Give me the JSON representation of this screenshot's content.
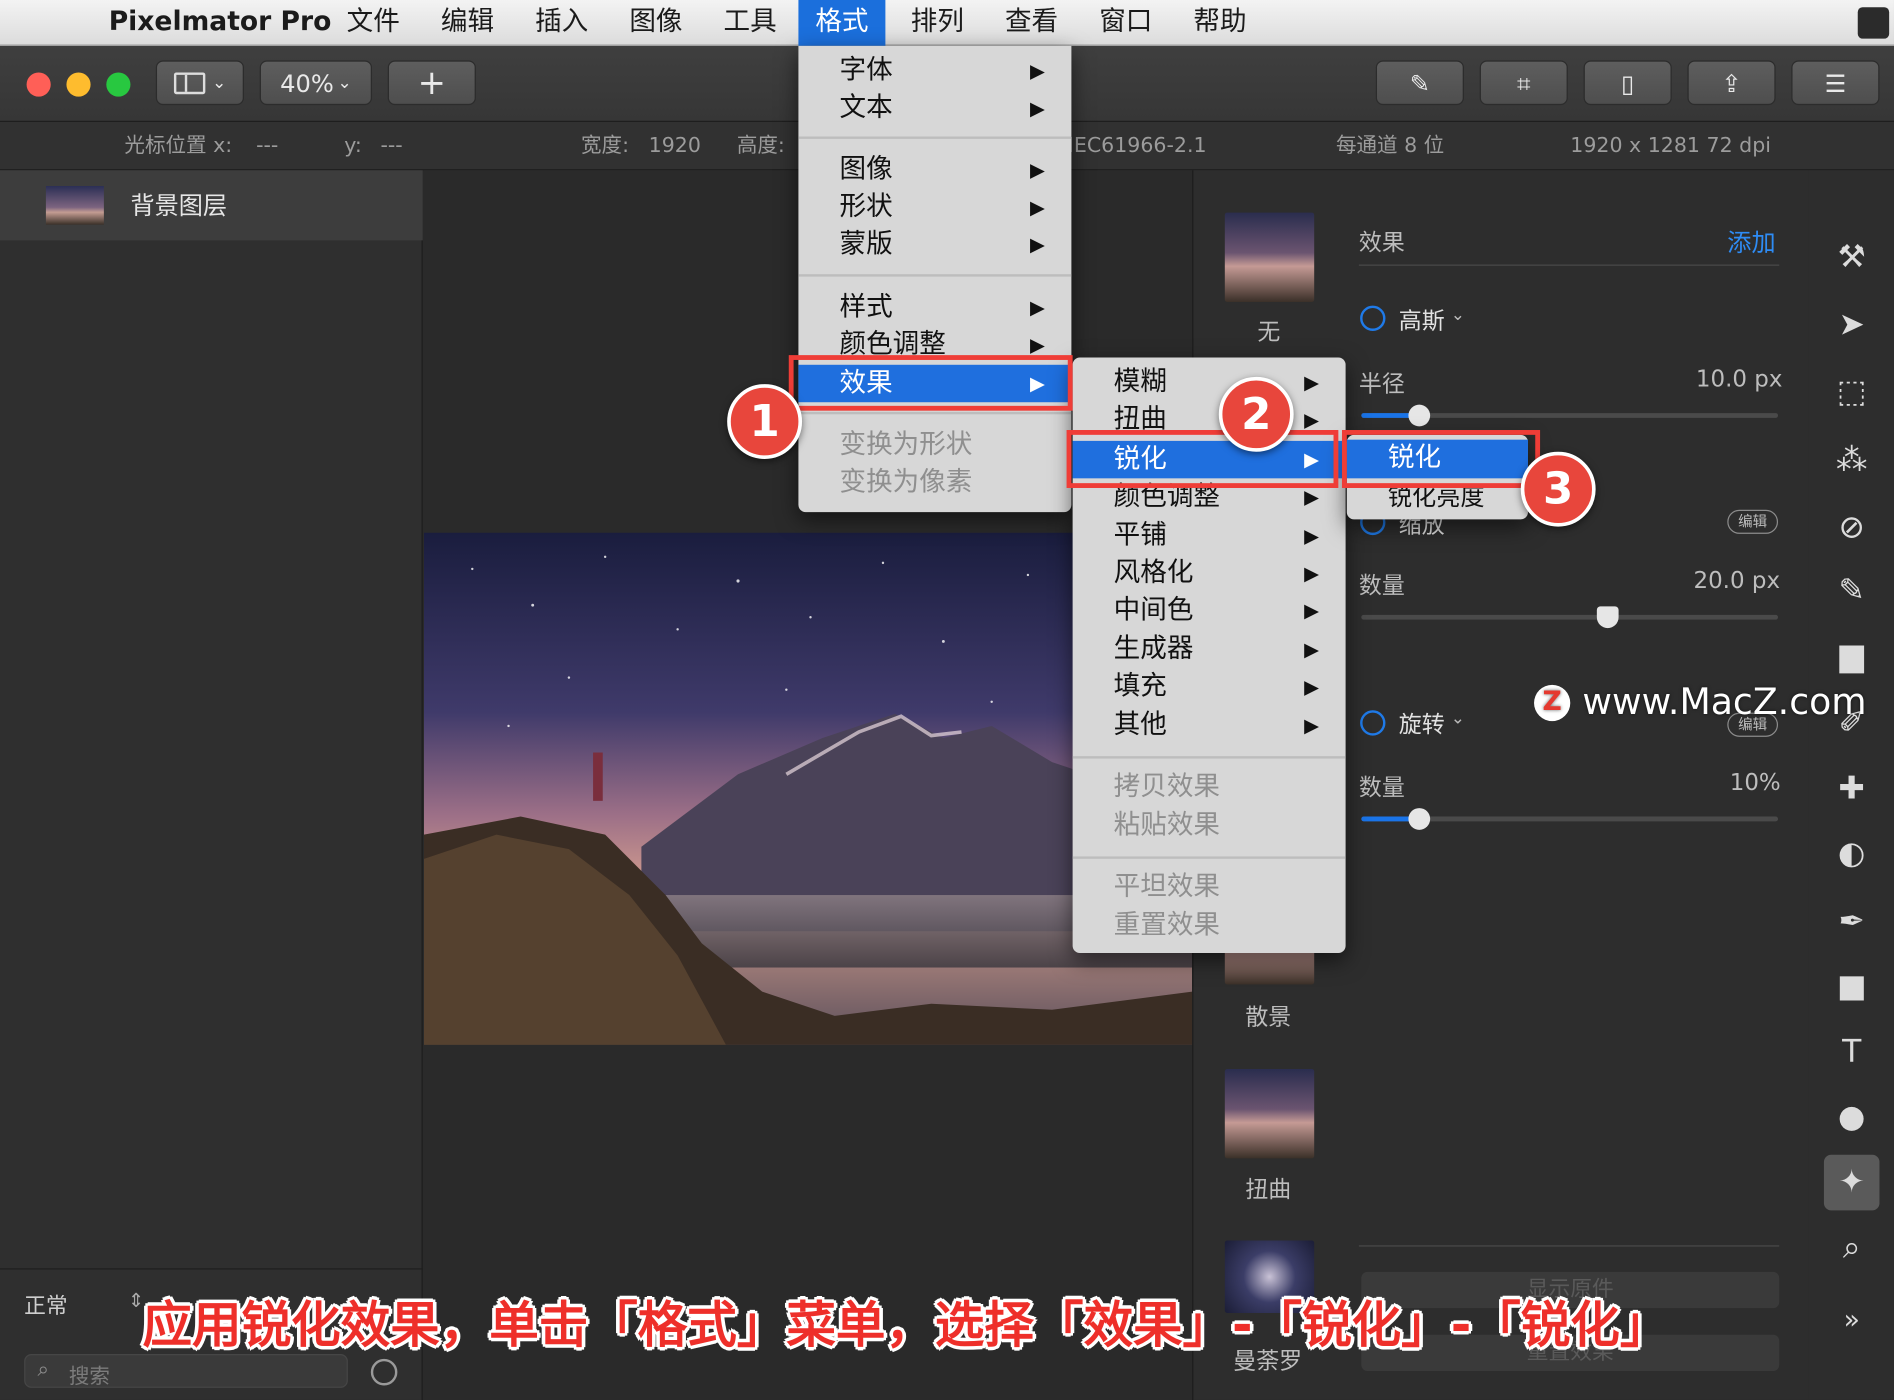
{
  "menubar": {
    "app_name": "Pixelmator Pro",
    "items": [
      "文件",
      "编辑",
      "插入",
      "图像",
      "工具",
      "格式",
      "排列",
      "查看",
      "窗口",
      "帮助"
    ],
    "active_item": "格式"
  },
  "toolbar": {
    "zoom": "40%",
    "add_label": "+"
  },
  "infobar": {
    "cursor_x_label": "光标位置 x:",
    "cursor_x_value": "---",
    "cursor_y_label": "y:",
    "cursor_y_value": "---",
    "width_label": "宽度:",
    "width_value": "1920",
    "height_label": "高度:",
    "color_profile": "IEC61966-2.1",
    "bit_depth": "每通道 8 位",
    "size_dpi": "1920 x 1281 72 dpi"
  },
  "layers": {
    "items": [
      "背景图层"
    ],
    "blend_mode": "正常",
    "search_placeholder": "搜索"
  },
  "effects_panel": {
    "title": "效果",
    "add_label": "添加",
    "presets": [
      "无",
      "散景",
      "扭曲",
      "曼荼罗"
    ],
    "effects": [
      {
        "name": "高斯",
        "param": "半径",
        "value": "10.0 px",
        "level": 0.14
      },
      {
        "name": "缩放",
        "param": "数量",
        "value": "20.0 px",
        "level": 0.59,
        "edit_label": "编辑"
      },
      {
        "name": "旋转",
        "param": "数量",
        "value": "10%",
        "level": 0.14,
        "edit_label": "编辑"
      }
    ],
    "show_original_label": "显示原件",
    "reset_label": "重置效果"
  },
  "format_menu": {
    "groups": [
      [
        {
          "label": "字体",
          "arrow": "▶"
        },
        {
          "label": "文本",
          "arrow": "▶"
        }
      ],
      [
        {
          "label": "图像",
          "arrow": "▶"
        },
        {
          "label": "形状",
          "arrow": "▶"
        },
        {
          "label": "蒙版",
          "arrow": "▶"
        }
      ],
      [
        {
          "label": "样式",
          "arrow": "▶"
        },
        {
          "label": "颜色调整",
          "arrow": "▶"
        },
        {
          "label": "效果",
          "arrow": "▶",
          "selected": true
        }
      ],
      [
        {
          "label": "变换为形状",
          "disabled": true
        },
        {
          "label": "变换为像素",
          "disabled": true
        }
      ]
    ]
  },
  "effects_submenu": {
    "groups": [
      [
        {
          "label": "模糊",
          "arrow": "▶"
        },
        {
          "label": "扭曲",
          "arrow": "▶"
        },
        {
          "label": "锐化",
          "arrow": "▶",
          "selected": true
        },
        {
          "label": "颜色调整",
          "arrow": "▶"
        },
        {
          "label": "平铺",
          "arrow": "▶"
        },
        {
          "label": "风格化",
          "arrow": "▶"
        },
        {
          "label": "中间色",
          "arrow": "▶"
        },
        {
          "label": "生成器",
          "arrow": "▶"
        },
        {
          "label": "填充",
          "arrow": "▶"
        },
        {
          "label": "其他",
          "arrow": "▶"
        }
      ],
      [
        {
          "label": "拷贝效果",
          "disabled": true
        },
        {
          "label": "粘贴效果",
          "disabled": true
        }
      ],
      [
        {
          "label": "平坦效果",
          "disabled": true
        },
        {
          "label": "重置效果",
          "disabled": true
        }
      ]
    ]
  },
  "sharpen_submenu": {
    "items": [
      {
        "label": "锐化",
        "selected": true
      },
      {
        "label": "锐化亮度"
      }
    ]
  },
  "annotations": {
    "step1": "1",
    "step2": "2",
    "step3": "3",
    "caption": "应用锐化效果，单击「格式」菜单，选择「效果」-「锐化」-「锐化」",
    "watermark": "www.MacZ.com",
    "watermark_logo": "Z"
  },
  "colors": {
    "accent": "#1f6fde",
    "annotation_red": "#ef3d37"
  }
}
